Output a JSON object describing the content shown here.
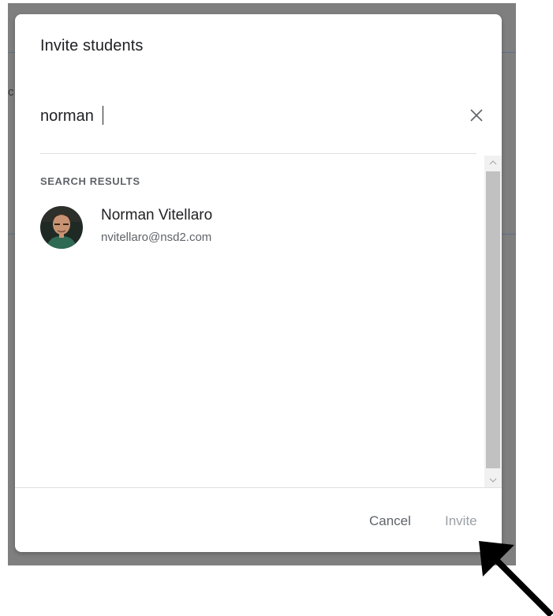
{
  "dialog": {
    "title": "Invite students"
  },
  "search": {
    "value": "norman",
    "placeholder": ""
  },
  "results": {
    "section_label": "SEARCH RESULTS",
    "items": [
      {
        "name": "Norman Vitellaro",
        "email": "nvitellaro@nsd2.com"
      }
    ]
  },
  "footer": {
    "cancel_label": "Cancel",
    "invite_label": "Invite"
  },
  "colors": {
    "backdrop": "#7f7f7f",
    "text_primary": "#202124",
    "text_secondary": "#5f6368",
    "disabled": "#9aa0a6"
  },
  "icons": {
    "clear": "close-icon",
    "scroll_up": "chevron-up-icon",
    "scroll_down": "chevron-down-icon",
    "pointer": "arrow-icon"
  }
}
